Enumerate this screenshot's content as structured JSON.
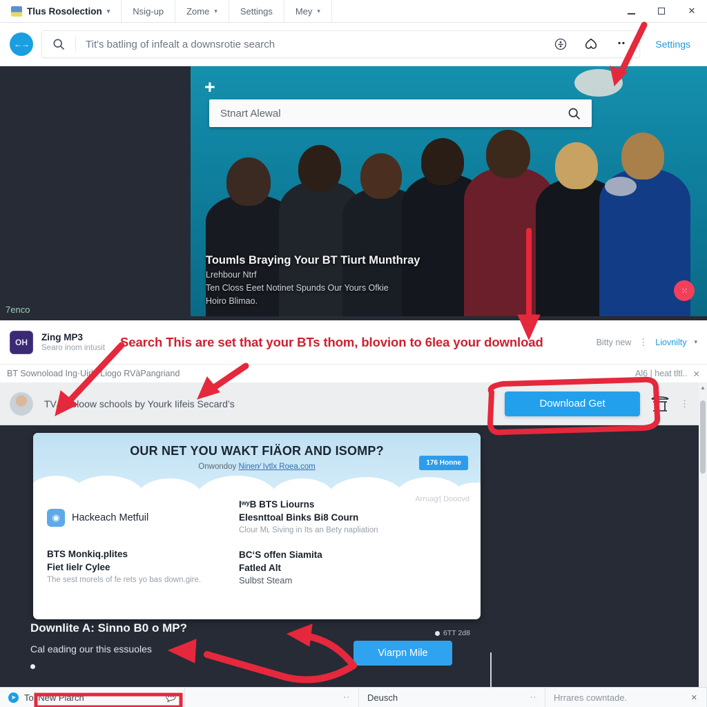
{
  "window": {
    "tabs": [
      {
        "label": "Tlus Rosolection",
        "has_favicon": true,
        "has_chevron": true,
        "active": true
      },
      {
        "label": "Nsig-up",
        "has_favicon": false,
        "has_chevron": false,
        "active": false
      },
      {
        "label": "Zome",
        "has_favicon": false,
        "has_chevron": true,
        "active": false
      },
      {
        "label": "Settings",
        "has_favicon": false,
        "has_chevron": false,
        "active": false
      },
      {
        "label": "Mey",
        "has_favicon": false,
        "has_chevron": true,
        "active": false
      }
    ],
    "controls": {
      "minimize": "minimize-icon",
      "maximize": "maximize-icon",
      "close": "✕"
    }
  },
  "omnibar": {
    "back_forward_icon": "back-forward-icon",
    "search_icon": "search-icon",
    "query": "Tit's batling of infealt a downsrotie search",
    "placeholder": "Search",
    "info_icon": "info-circle-icon",
    "heart_icon": "heart-icon",
    "more_icon": "more-dots-icon",
    "settings_label": "Settings"
  },
  "hero": {
    "plus_icon": "plus-icon",
    "search_value": "Stnart Alewal",
    "search_placeholder": "Search",
    "search_icon": "search-icon",
    "caption_title": "Toumls Braying Your BT Tiurt Munthray",
    "caption_line2": "Lrehbour Ntrf",
    "caption_line3": "Ten Closs Eeet Notinet Spunds Our Yours Ofkie",
    "caption_line4": "Hoiro Blimao.",
    "badge_label": "⁙",
    "stage_label": "7enco"
  },
  "app_row": {
    "icon_label": "OH",
    "name": "Zing MP3",
    "subtitle": "Searo inom intusit",
    "annotation": "Search This are set that your BTs thom, blovion to 6lea your download",
    "right_text": "Bitty new",
    "kebab_icon": "kebab-menu-icon",
    "right_link": "Liovnilty",
    "chevron_icon": "chevron-down-icon"
  },
  "breadcrumb": {
    "path": "BT Sownoload Ing·Uirle Liogo RVàPangriand",
    "right_text": "Al6 | heat tltl..",
    "close_icon": "✕"
  },
  "download_bar": {
    "avatar": "user-avatar",
    "title": "TV/-Woloow schools by Yourk Iifeis Secard’s",
    "button_label": "Download Get",
    "torii_icon": "torii-gate-icon",
    "kebab_icon": "kebab-menu-icon"
  },
  "card": {
    "headline": "OUR NET YOU WAKT FIÄOR AND ISOMP?",
    "subline_prefix": "Onwondoy ",
    "subline_link": "Ninen⁄ Ivtlx Roea.com",
    "left_items": [
      {
        "icon": "globe-icon",
        "title": "Hackeach Metfuil",
        "sub": "",
        "sub2": "",
        "desc": ""
      },
      {
        "icon": "",
        "title": "BTS Monkiq.plites",
        "sub": "Fiet Iielr Cylee",
        "sub2": "",
        "desc": "The sest morels of fe rets yo bas down.gire."
      }
    ],
    "right_items": [
      {
        "icon": "",
        "title": "IʷʸB BTS Liourns",
        "sub": "Elesnttoal Binks Bi8 Courn",
        "sub2": "",
        "desc": "Clour Mʟ Siving in Its an Bety napliation"
      },
      {
        "icon": "",
        "title": "BCʻS offen Siamita",
        "sub": "Fatled Alt",
        "sub2": "Sulbst Steam",
        "desc": ""
      }
    ],
    "pill_label": "176 Honne",
    "footer_note": "Arruag⁄| Dooovd",
    "meta_label": "6TT 2d8"
  },
  "promo": {
    "heading": "Downlite A: Sinno B0 o MP?",
    "paragraph": "Cal eading our this essuoles",
    "button_label": "Viarpn Mile"
  },
  "taskbar": {
    "items": [
      {
        "label": "Tol New Plarch",
        "icon": "twitter-bird-icon",
        "bubble": "comment-icon",
        "dots": ""
      },
      {
        "label": "",
        "icon": "",
        "bubble": "",
        "dots": "··"
      },
      {
        "label": "Deusch",
        "icon": "",
        "bubble": "",
        "dots": "··"
      },
      {
        "label": "Hrrares cowntade.",
        "icon": "",
        "bubble": "",
        "dots": "✕"
      }
    ]
  },
  "colors": {
    "accent_blue": "#22a0ec",
    "link_blue": "#1f9ad6",
    "annotation_red": "#cf2030",
    "dark_bg": "#262b36",
    "hero_teal": "#0e7f9d",
    "badge_pink": "#f3405a"
  }
}
